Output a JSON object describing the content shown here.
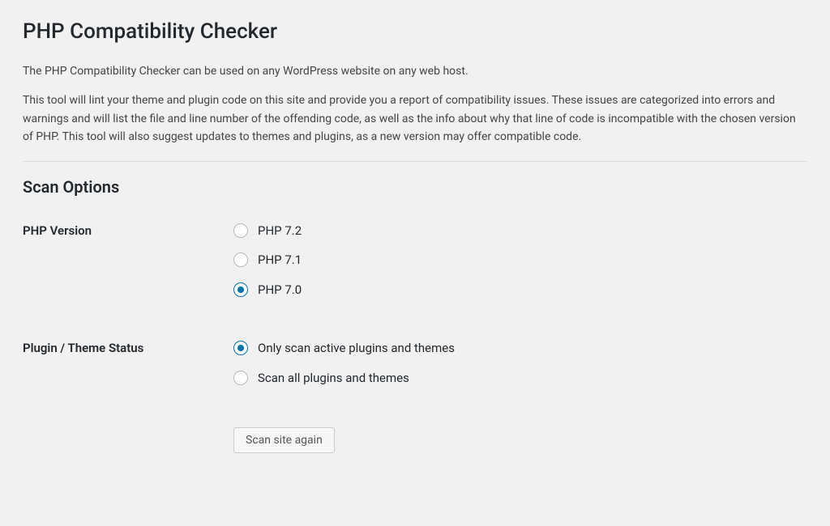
{
  "page": {
    "title": "PHP Compatibility Checker",
    "intro1": "The PHP Compatibility Checker can be used on any WordPress website on any web host.",
    "intro2": "This tool will lint your theme and plugin code on this site and provide you a report of compatibility issues. These issues are categorized into errors and warnings and will list the file and line number of the offending code, as well as the info about why that line of code is incompatible with the chosen version of PHP. This tool will also suggest updates to themes and plugins, as a new version may offer compatible code."
  },
  "scan": {
    "heading": "Scan Options",
    "phpVersion": {
      "label": "PHP Version",
      "options": {
        "0": "PHP 7.2",
        "1": "PHP 7.1",
        "2": "PHP 7.0"
      }
    },
    "pluginStatus": {
      "label": "Plugin / Theme Status",
      "options": {
        "0": "Only scan active plugins and themes",
        "1": "Scan all plugins and themes"
      }
    },
    "submitLabel": "Scan site again"
  }
}
